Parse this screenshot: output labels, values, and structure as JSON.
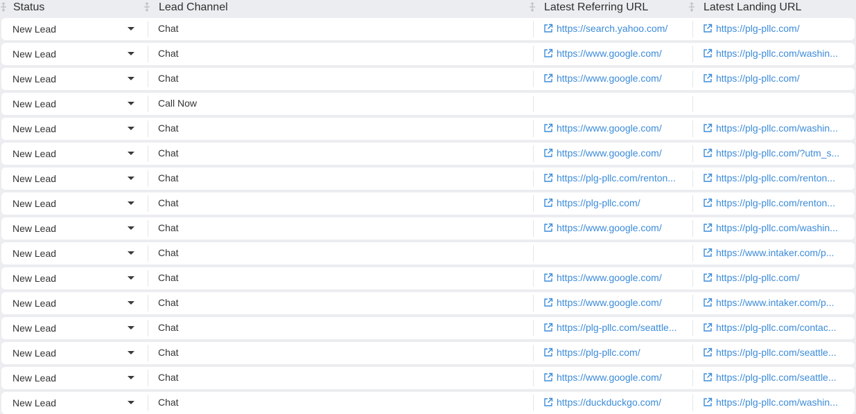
{
  "colors": {
    "background": "#ebedf0",
    "row_background": "#ffffff",
    "link": "#3b8bd9",
    "text": "#333333"
  },
  "header": {
    "status": "Status",
    "lead_channel": "Lead Channel",
    "latest_referring_url": "Latest Referring URL",
    "latest_landing_url": "Latest Landing URL"
  },
  "icons": {
    "drag_handle": "drag-handle-icon",
    "dropdown": "caret-down-icon",
    "external_link": "external-link-icon"
  },
  "rows": [
    {
      "status": "New Lead",
      "channel": "Chat",
      "referring_url": "https://search.yahoo.com/",
      "landing_url": "https://plg-pllc.com/"
    },
    {
      "status": "New Lead",
      "channel": "Chat",
      "referring_url": "https://www.google.com/",
      "landing_url": "https://plg-pllc.com/washin..."
    },
    {
      "status": "New Lead",
      "channel": "Chat",
      "referring_url": "https://www.google.com/",
      "landing_url": "https://plg-pllc.com/"
    },
    {
      "status": "New Lead",
      "channel": "Call Now",
      "referring_url": "",
      "landing_url": ""
    },
    {
      "status": "New Lead",
      "channel": "Chat",
      "referring_url": "https://www.google.com/",
      "landing_url": "https://plg-pllc.com/washin..."
    },
    {
      "status": "New Lead",
      "channel": "Chat",
      "referring_url": "https://www.google.com/",
      "landing_url": "https://plg-pllc.com/?utm_s..."
    },
    {
      "status": "New Lead",
      "channel": "Chat",
      "referring_url": "https://plg-pllc.com/renton...",
      "landing_url": "https://plg-pllc.com/renton..."
    },
    {
      "status": "New Lead",
      "channel": "Chat",
      "referring_url": "https://plg-pllc.com/",
      "landing_url": "https://plg-pllc.com/renton..."
    },
    {
      "status": "New Lead",
      "channel": "Chat",
      "referring_url": "https://www.google.com/",
      "landing_url": "https://plg-pllc.com/washin..."
    },
    {
      "status": "New Lead",
      "channel": "Chat",
      "referring_url": "",
      "landing_url": "https://www.intaker.com/p..."
    },
    {
      "status": "New Lead",
      "channel": "Chat",
      "referring_url": "https://www.google.com/",
      "landing_url": "https://plg-pllc.com/"
    },
    {
      "status": "New Lead",
      "channel": "Chat",
      "referring_url": "https://www.google.com/",
      "landing_url": "https://www.intaker.com/p..."
    },
    {
      "status": "New Lead",
      "channel": "Chat",
      "referring_url": "https://plg-pllc.com/seattle...",
      "landing_url": "https://plg-pllc.com/contac..."
    },
    {
      "status": "New Lead",
      "channel": "Chat",
      "referring_url": "https://plg-pllc.com/",
      "landing_url": "https://plg-pllc.com/seattle..."
    },
    {
      "status": "New Lead",
      "channel": "Chat",
      "referring_url": "https://www.google.com/",
      "landing_url": "https://plg-pllc.com/seattle..."
    },
    {
      "status": "New Lead",
      "channel": "Chat",
      "referring_url": "https://duckduckgo.com/",
      "landing_url": "https://plg-pllc.com/washin..."
    }
  ]
}
